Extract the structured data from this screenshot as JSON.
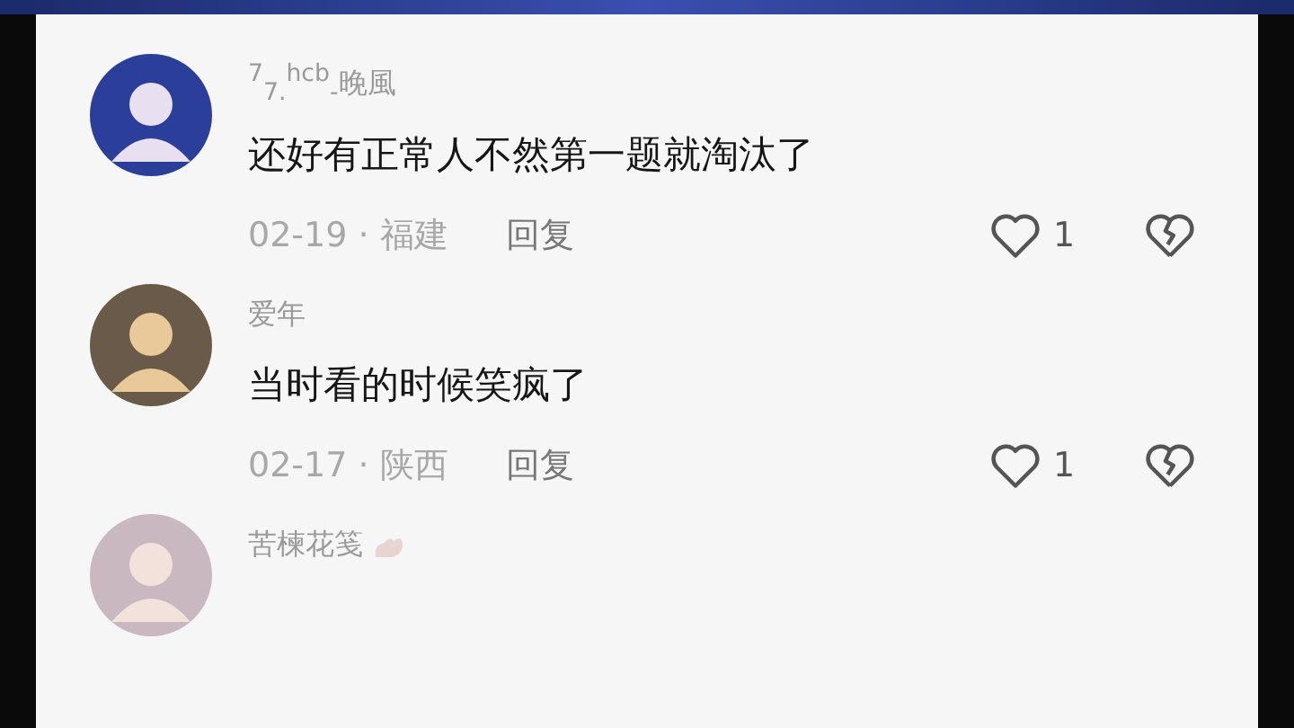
{
  "comments": [
    {
      "name": "$^{7}$$_{7.}$$^{hcb}$$_{-}$晚風",
      "name_badge": false,
      "text": "还好有正常人不然第一题就淘汰了",
      "date": "02-19",
      "separator": "·",
      "location": "福建",
      "reply": "回复",
      "likes": "1",
      "liked": false
    },
    {
      "name": "爱年",
      "name_badge": false,
      "text": "当时看的时候笑疯了",
      "date": "02-17",
      "separator": "·",
      "location": "陕西",
      "reply": "回复",
      "likes": "1",
      "liked": false
    },
    {
      "name": "苦楝花笺",
      "name_badge": true
    }
  ]
}
